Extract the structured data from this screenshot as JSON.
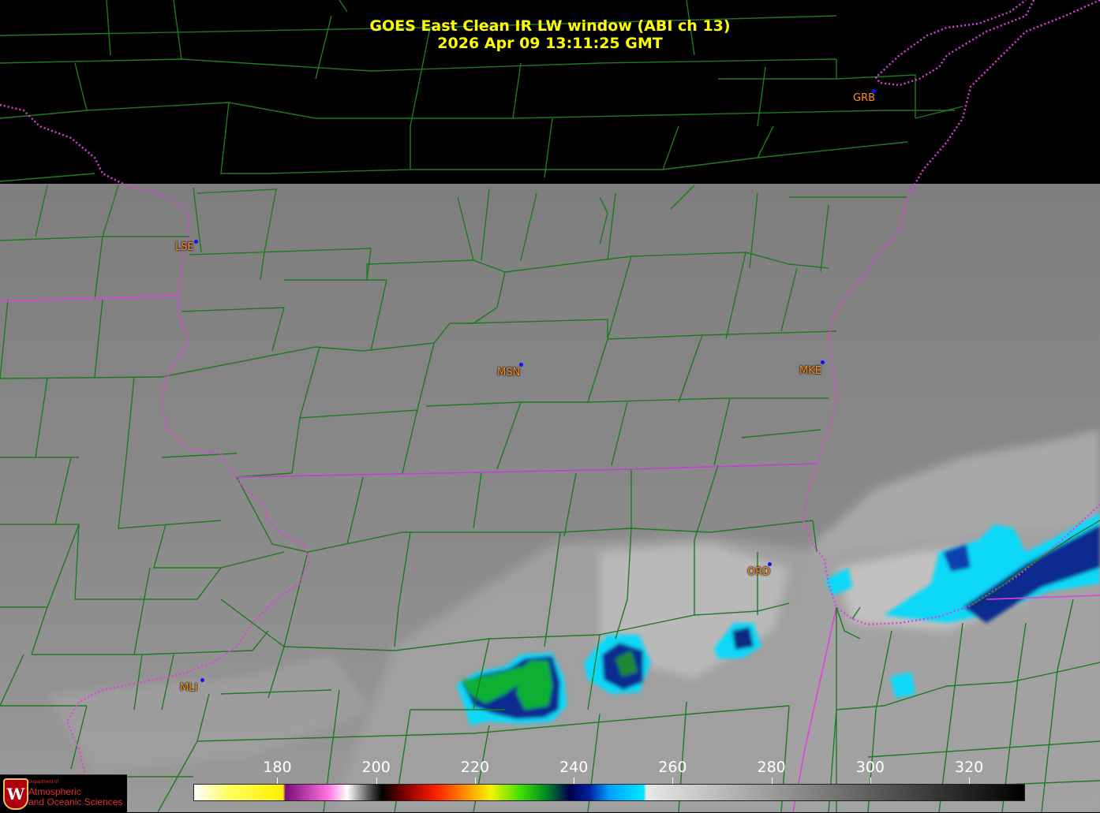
{
  "header": {
    "title_line1": "GOES East Clean IR LW window (ABI ch 13)",
    "title_line2": "2026 Apr 09  13:11:25 GMT"
  },
  "stations": [
    {
      "id": "GRB",
      "label": "GRB"
    },
    {
      "id": "LSE",
      "label": "LSE"
    },
    {
      "id": "MSN",
      "label": "MSN"
    },
    {
      "id": "MKE",
      "label": "MKE"
    },
    {
      "id": "ORD",
      "label": "ORD"
    },
    {
      "id": "MLI",
      "label": "MLI"
    }
  ],
  "colorbar": {
    "ticks": [
      "180",
      "200",
      "220",
      "240",
      "260",
      "280",
      "300",
      "320"
    ],
    "range": [
      163,
      331
    ],
    "stops": [
      {
        "value": 163,
        "color": "#ffffff"
      },
      {
        "value": 170,
        "color": "#ffff60"
      },
      {
        "value": 181,
        "color": "#ffee00"
      },
      {
        "value": 181.5,
        "color": "#7a0d7a"
      },
      {
        "value": 190,
        "color": "#ff70e0"
      },
      {
        "value": 194,
        "color": "#ffffff"
      },
      {
        "value": 199,
        "color": "#404040"
      },
      {
        "value": 201,
        "color": "#000000"
      },
      {
        "value": 206,
        "color": "#8a0000"
      },
      {
        "value": 212,
        "color": "#ff2000"
      },
      {
        "value": 218,
        "color": "#ff9000"
      },
      {
        "value": 223,
        "color": "#f4f400"
      },
      {
        "value": 229,
        "color": "#40e000"
      },
      {
        "value": 234,
        "color": "#009020"
      },
      {
        "value": 239,
        "color": "#000050"
      },
      {
        "value": 243,
        "color": "#0020a0"
      },
      {
        "value": 247,
        "color": "#00a0ff"
      },
      {
        "value": 254,
        "color": "#00e8ff"
      },
      {
        "value": 254.5,
        "color": "#e8e8e8"
      },
      {
        "value": 331,
        "color": "#000000"
      }
    ]
  },
  "logo": {
    "crest_letter": "W",
    "line_small": "Department of",
    "line1": "Atmospheric",
    "line2": "and Oceanic Sciences"
  },
  "colors": {
    "county_lines": "#1e7a1e",
    "state_lines": "#e040e0",
    "title": "#ffff00",
    "station_label": "#ff8c1a",
    "station_dot": "#1010ff"
  }
}
